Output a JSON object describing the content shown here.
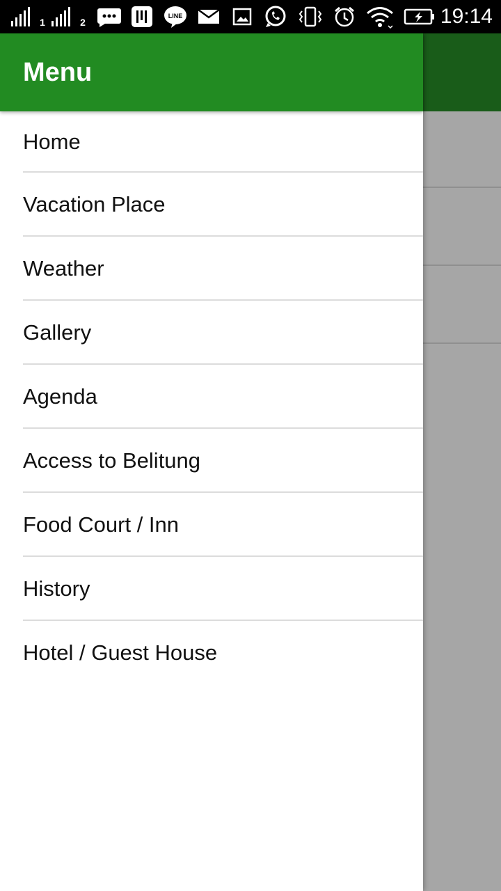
{
  "status_bar": {
    "sim1_label": "1",
    "sim2_label": "2",
    "time": "19:14",
    "icons": [
      "signal-icon",
      "signal-icon",
      "bbm-icon",
      "gojek-icon",
      "line-icon",
      "email-icon",
      "gallery-icon",
      "whatsapp-icon",
      "vibrate-icon",
      "alarm-icon",
      "wifi-icon",
      "battery-charging-icon"
    ],
    "line_badge": "LINE"
  },
  "drawer": {
    "title": "Menu",
    "items": [
      {
        "label": "Home"
      },
      {
        "label": "Vacation Place"
      },
      {
        "label": "Weather"
      },
      {
        "label": "Gallery"
      },
      {
        "label": "Agenda"
      },
      {
        "label": "Access to Belitung"
      },
      {
        "label": "Food Court / Inn"
      },
      {
        "label": "History"
      },
      {
        "label": "Hotel / Guest House"
      }
    ]
  },
  "colors": {
    "header": "#228b22",
    "scrim_toolbar": "#195c19",
    "scrim": "#a6a6a6"
  }
}
